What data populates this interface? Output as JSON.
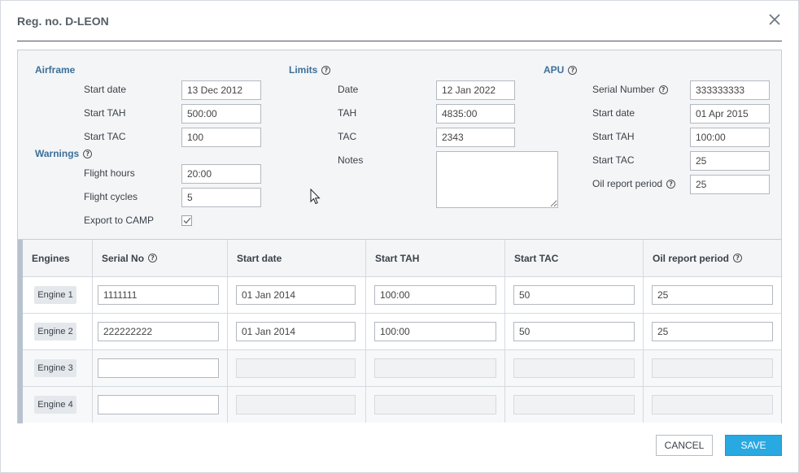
{
  "dialog": {
    "title": "Reg. no. D-LEON",
    "close_icon": "close-icon"
  },
  "airframe": {
    "header": "Airframe",
    "start_date_label": "Start date",
    "start_date_value": "13 Dec 2012",
    "start_tah_label": "Start TAH",
    "start_tah_value": "500:00",
    "start_tac_label": "Start TAC",
    "start_tac_value": "100"
  },
  "warnings": {
    "header": "Warnings",
    "flight_hours_label": "Flight hours",
    "flight_hours_value": "20:00",
    "flight_cycles_label": "Flight cycles",
    "flight_cycles_value": "5",
    "export_label": "Export to CAMP",
    "export_checked": true
  },
  "limits": {
    "header": "Limits",
    "date_label": "Date",
    "date_value": "12 Jan 2022",
    "tah_label": "TAH",
    "tah_value": "4835:00",
    "tac_label": "TAC",
    "tac_value": "2343",
    "notes_label": "Notes",
    "notes_value": ""
  },
  "apu": {
    "header": "APU",
    "serial_label": "Serial Number",
    "serial_value": "333333333",
    "start_date_label": "Start date",
    "start_date_value": "01 Apr 2015",
    "start_tah_label": "Start TAH",
    "start_tah_value": "100:00",
    "start_tac_label": "Start TAC",
    "start_tac_value": "25",
    "oil_label": "Oil report period",
    "oil_value": "25"
  },
  "engines": {
    "columns": [
      "Engines",
      "Serial No",
      "Start date",
      "Start TAH",
      "Start TAC",
      "Oil report period"
    ],
    "rows": [
      {
        "name": "Engine 1",
        "serial": "1111111",
        "start_date": "01 Jan 2014",
        "start_tah": "100:00",
        "start_tac": "50",
        "oil": "25"
      },
      {
        "name": "Engine 2",
        "serial": "222222222",
        "start_date": "01 Jan 2014",
        "start_tah": "100:00",
        "start_tac": "50",
        "oil": "25"
      },
      {
        "name": "Engine 3",
        "serial": "",
        "start_date": "",
        "start_tah": "",
        "start_tac": "",
        "oil": ""
      },
      {
        "name": "Engine 4",
        "serial": "",
        "start_date": "",
        "start_tah": "",
        "start_tac": "",
        "oil": ""
      }
    ]
  },
  "buttons": {
    "cancel": "CANCEL",
    "save": "SAVE"
  },
  "colors": {
    "section_header": "#3c6f97",
    "save_button": "#29a9e1",
    "row_bar": "#b8c2cf"
  }
}
